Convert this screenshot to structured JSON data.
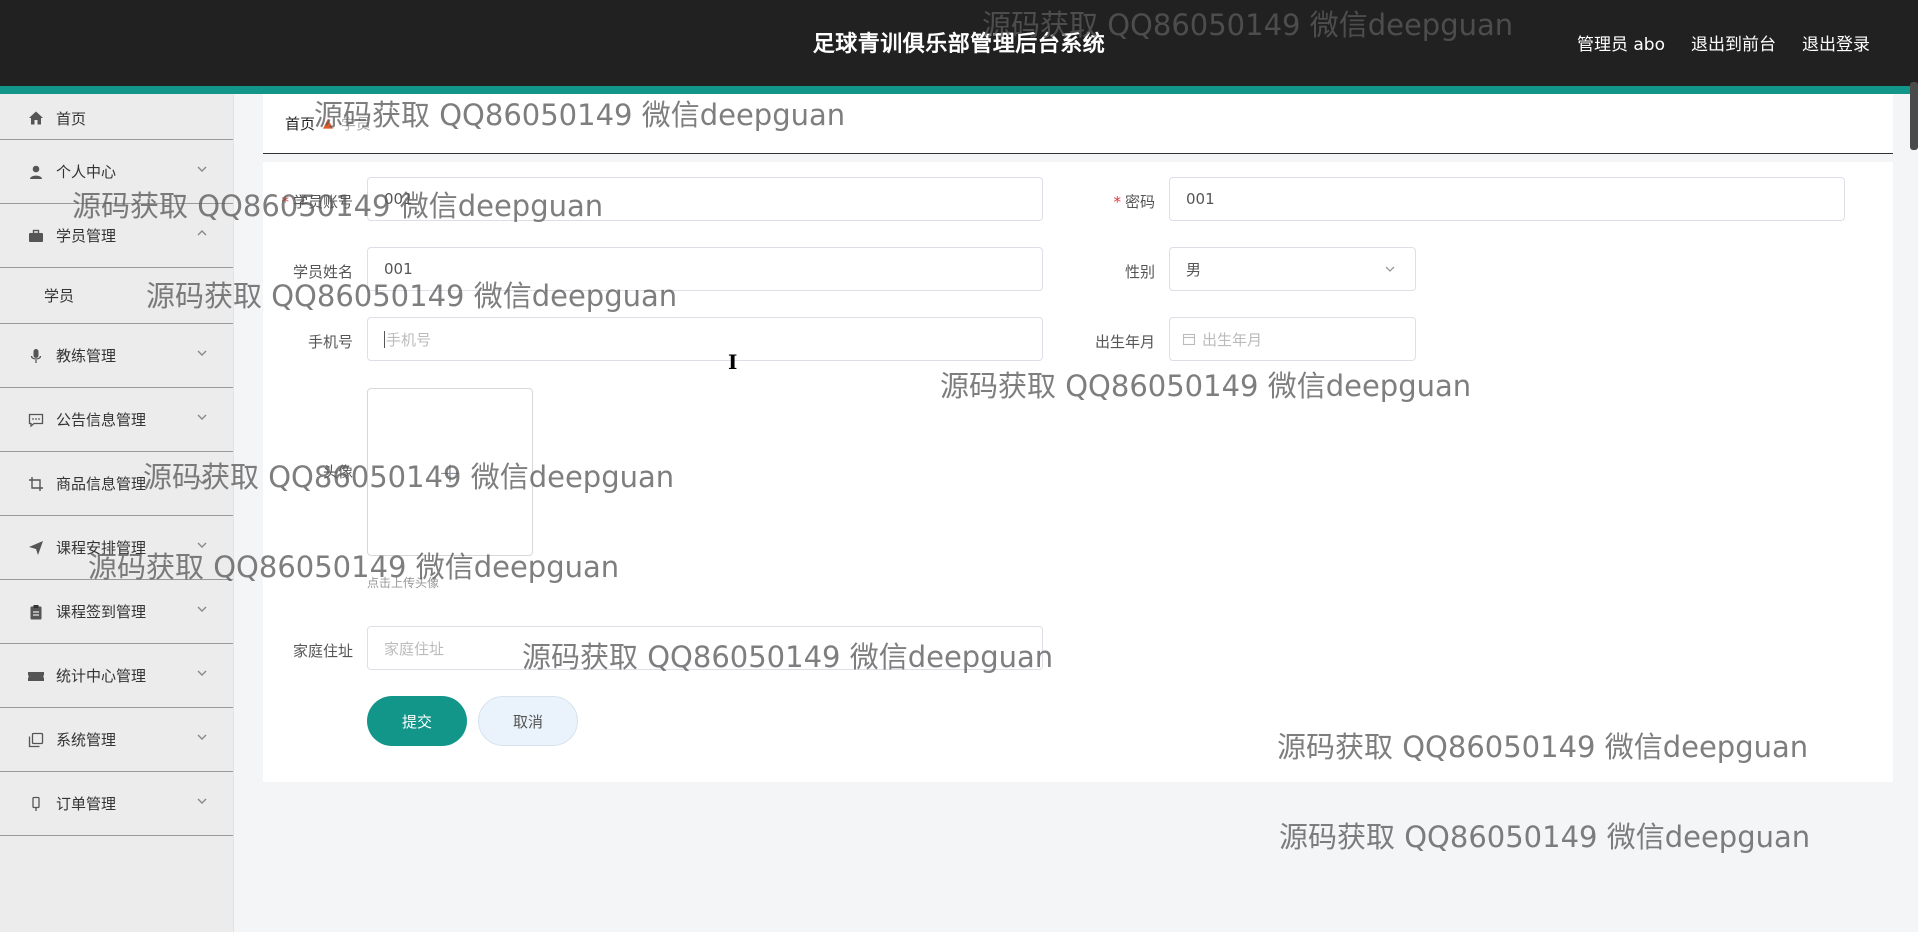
{
  "header": {
    "title": "足球青训俱乐部管理后台系统",
    "user_label": "管理员 abo",
    "to_front_label": "退出到前台",
    "logout_label": "退出登录"
  },
  "sidebar": {
    "items": [
      {
        "label": "首页",
        "icon": "home-icon"
      },
      {
        "label": "个人中心",
        "icon": "user-icon"
      },
      {
        "label": "学员管理",
        "icon": "briefcase-icon",
        "sub": [
          "学员"
        ]
      },
      {
        "label": "教练管理",
        "icon": "microphone-icon"
      },
      {
        "label": "公告信息管理",
        "icon": "chat-icon"
      },
      {
        "label": "商品信息管理",
        "icon": "crop-icon"
      },
      {
        "label": "课程安排管理",
        "icon": "send-icon"
      },
      {
        "label": "课程签到管理",
        "icon": "clipboard-icon"
      },
      {
        "label": "统计中心管理",
        "icon": "ticket-icon"
      },
      {
        "label": "系统管理",
        "icon": "copy-icon"
      },
      {
        "label": "订单管理",
        "icon": "bookmark-icon"
      }
    ]
  },
  "breadcrumb": {
    "home": "首页",
    "current": "学员"
  },
  "form": {
    "account_label": "学员账号",
    "account_value": "001",
    "password_label": "密码",
    "password_value": "001",
    "name_label": "学员姓名",
    "name_value": "001",
    "gender_label": "性别",
    "gender_value": "男",
    "phone_label": "手机号",
    "phone_placeholder": "手机号",
    "birth_label": "出生年月",
    "birth_placeholder": "出生年月",
    "avatar_label": "头像",
    "avatar_hint": "点击上传头像",
    "address_label": "家庭住址",
    "address_placeholder": "家庭住址",
    "submit_label": "提交",
    "cancel_label": "取消"
  },
  "watermark": "源码获取 QQ86050149 微信deepguan",
  "colors": {
    "accent": "#12968a",
    "header_bg": "#212121",
    "required": "#e33333"
  }
}
